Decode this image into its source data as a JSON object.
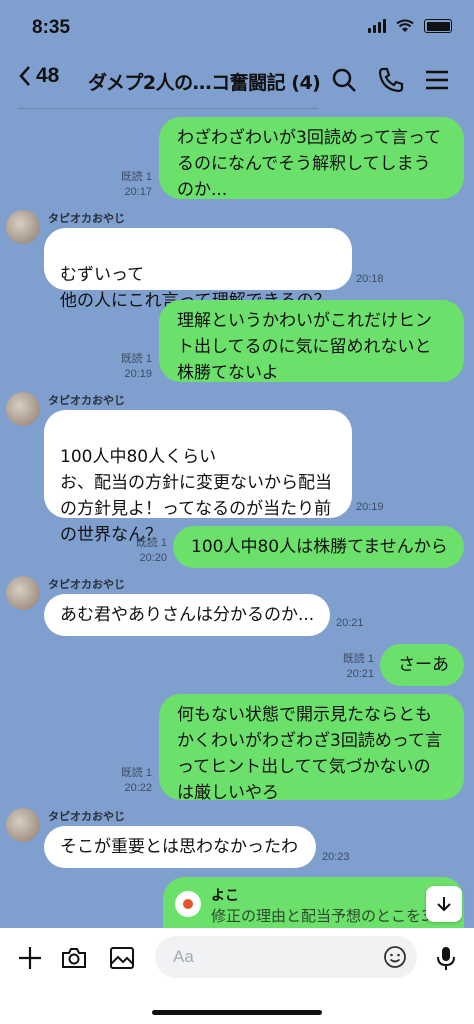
{
  "status": {
    "time": "8:35"
  },
  "header": {
    "back_count": "48",
    "title": "ダメプ2人の…コ奮闘記 (4)"
  },
  "messages": [
    {
      "text": "わざわざわいが3回読めって言ってるのになんでそう解釈してしまうのか...",
      "read": "既読 1",
      "time": "20:17"
    },
    {
      "sender": "タピオカおやじ",
      "text": "むずいって\n他の人にこれ言って理解できるの？",
      "time": "20:18"
    },
    {
      "text": "理解というかわいがこれだけヒント出してるのに気に留めれないと株勝てないよ",
      "read": "既読 1",
      "time": "20:19"
    },
    {
      "sender": "タピオカおやじ",
      "text": "100人中80人くらい\nお、配当の方針に変更ないから配当の方針見よ！ってなるのが当たり前の世界なん？",
      "time": "20:19"
    },
    {
      "text": "100人中80人は株勝てませんから",
      "read": "既読 1",
      "time": "20:20"
    },
    {
      "sender": "タピオカおやじ",
      "text": "あむ君やありさんは分かるのか...",
      "time": "20:21"
    },
    {
      "text": "さーあ",
      "read": "既読 1",
      "time": "20:21"
    },
    {
      "text": "何もない状態で開示見たならともかくわいがわざわざ3回読めって言ってヒント出してて気づかないのは厳しいやろ",
      "read": "既読 1",
      "time": "20:22"
    },
    {
      "sender": "タピオカおやじ",
      "text": "そこが重要とは思わなかったわ",
      "time": "20:23"
    },
    {
      "reply_name": "よこ",
      "reply_text": "修正の理由と配当予想のとこを3"
    }
  ],
  "composer": {
    "placeholder": "Aa"
  },
  "colors": {
    "background": "#7fa0ce",
    "my_bubble": "#6be06a",
    "their_bubble": "#ffffff"
  },
  "icons": [
    "back-chevron-icon",
    "search-icon",
    "phone-icon",
    "menu-icon",
    "plus-icon",
    "camera-icon",
    "image-icon",
    "emoji-icon",
    "mic-icon",
    "scroll-down-icon"
  ]
}
